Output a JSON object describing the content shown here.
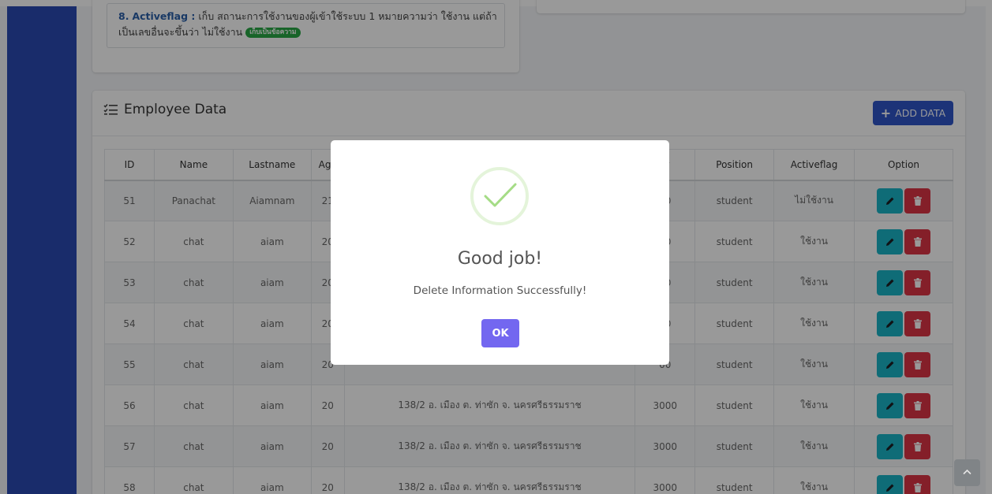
{
  "note": {
    "item_number": "8.",
    "key": "Activeflag :",
    "text_line1": "เก็บ สถานะการใช้งานของผู้เข้าใช้ระบบ 1 หมายความว่า ใช้งาน แต่ถ้า",
    "text_line2": "เป็นเลขอื่นจะขึ้นว่า ไม่ใช้งาน",
    "badge": "เก็บเป็นข้อความ"
  },
  "data_card": {
    "title": "Employee Data",
    "add_button": "ADD DATA",
    "add_icon": "+"
  },
  "table": {
    "columns": [
      "ID",
      "Name",
      "Lastname",
      "Age",
      "",
      "ry",
      "Position",
      "Activeflag",
      "Option"
    ],
    "rows": [
      {
        "id": "51",
        "name": "Panachat",
        "lastname": "Aiamnam",
        "age": "21",
        "address": "",
        "salary": "00",
        "position": "student",
        "flag": "ไม่ใช้งาน"
      },
      {
        "id": "52",
        "name": "chat",
        "lastname": "aiam",
        "age": "20",
        "address": "",
        "salary": "00",
        "position": "student",
        "flag": "ใช้งาน"
      },
      {
        "id": "53",
        "name": "chat",
        "lastname": "aiam",
        "age": "20",
        "address": "",
        "salary": "00",
        "position": "student",
        "flag": "ใช้งาน"
      },
      {
        "id": "54",
        "name": "chat",
        "lastname": "aiam",
        "age": "20",
        "address": "",
        "salary": "00",
        "position": "student",
        "flag": "ใช้งาน"
      },
      {
        "id": "55",
        "name": "chat",
        "lastname": "aiam",
        "age": "20",
        "address": "",
        "salary": "00",
        "position": "student",
        "flag": "ใช้งาน"
      },
      {
        "id": "56",
        "name": "chat",
        "lastname": "aiam",
        "age": "20",
        "address": "138/2 อ. เมือง ต. ท่าซัก จ. นครศรีธรรมราช",
        "salary": "3000",
        "position": "student",
        "flag": "ใช้งาน"
      },
      {
        "id": "57",
        "name": "chat",
        "lastname": "aiam",
        "age": "20",
        "address": "138/2 อ. เมือง ต. ท่าซัก จ. นครศรีธรรมราช",
        "salary": "3000",
        "position": "student",
        "flag": "ใช้งาน"
      },
      {
        "id": "58",
        "name": "chat",
        "lastname": "aiam",
        "age": "20",
        "address": "138/2 อ. เมือง ต. ท่าซัก จ. นครศรีธรรมราช",
        "salary": "3000",
        "position": "student",
        "flag": "ใช้งาน"
      }
    ]
  },
  "modal": {
    "title": "Good job!",
    "text": "Delete Information Successfully!",
    "ok": "OK"
  },
  "icons": {
    "title": "list-check-icon",
    "edit": "pencil-icon",
    "delete": "trash-icon",
    "success": "checkmark-icon",
    "scroll": "chevron-up-icon"
  },
  "colors": {
    "sidebar": "#2b4ab3",
    "primary": "#2f55c8",
    "edit": "#1ab5c7",
    "delete": "#dc3545",
    "ok": "#7367f0",
    "success": "#a5dc86",
    "badge": "#28a745"
  }
}
